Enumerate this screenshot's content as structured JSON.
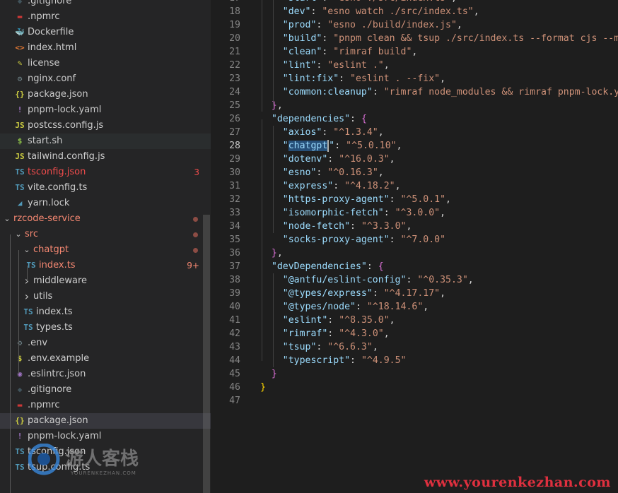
{
  "explorer": {
    "items": [
      {
        "label": ".gitignore",
        "icon": "git-icon",
        "glyph": "◆",
        "color": "#41535b",
        "indent": 1
      },
      {
        "label": ".npmrc",
        "icon": "npm-icon",
        "glyph": "▬",
        "color": "#cb3837",
        "indent": 1
      },
      {
        "label": "Dockerfile",
        "icon": "docker-icon",
        "glyph": "🐳",
        "color": "#0db7ed",
        "indent": 1
      },
      {
        "label": "index.html",
        "icon": "html-icon",
        "glyph": "<>",
        "color": "#e37933",
        "indent": 1
      },
      {
        "label": "license",
        "icon": "license-icon",
        "glyph": "✎",
        "color": "#cbcb41",
        "indent": 1
      },
      {
        "label": "nginx.conf",
        "icon": "gear-icon",
        "glyph": "⚙",
        "color": "#6d8086",
        "indent": 1
      },
      {
        "label": "package.json",
        "icon": "json-icon",
        "glyph": "{}",
        "color": "#cbcb41",
        "indent": 1
      },
      {
        "label": "pnpm-lock.yaml",
        "icon": "yaml-icon",
        "glyph": "!",
        "color": "#a074c4",
        "indent": 1
      },
      {
        "label": "postcss.config.js",
        "icon": "js-icon",
        "glyph": "JS",
        "color": "#cbcb41",
        "indent": 1
      },
      {
        "label": "start.sh",
        "icon": "shell-icon",
        "glyph": "$",
        "color": "#8dc149",
        "indent": 1,
        "hover": true
      },
      {
        "label": "tailwind.config.js",
        "icon": "js-icon",
        "glyph": "JS",
        "color": "#cbcb41",
        "indent": 1
      },
      {
        "label": "tsconfig.json",
        "icon": "ts-icon",
        "glyph": "TS",
        "color": "#519aba",
        "indent": 1,
        "labelColor": "#f14c4c",
        "badge": "3",
        "badgeColor": "#f14c4c"
      },
      {
        "label": "vite.config.ts",
        "icon": "ts-icon",
        "glyph": "TS",
        "color": "#519aba",
        "indent": 1
      },
      {
        "label": "yarn.lock",
        "icon": "yarn-icon",
        "glyph": "◢",
        "color": "#519aba",
        "indent": 1
      },
      {
        "label": "rzcode-service",
        "icon": "folder-icon",
        "folder": true,
        "open": true,
        "indent": 0,
        "labelColor": "#f48771",
        "dot": true
      },
      {
        "label": "src",
        "icon": "folder-icon",
        "folder": true,
        "open": true,
        "indent": 1,
        "labelColor": "#f48771",
        "dot": true
      },
      {
        "label": "chatgpt",
        "icon": "folder-icon",
        "folder": true,
        "open": true,
        "indent": 2,
        "labelColor": "#f48771",
        "dot": true
      },
      {
        "label": "index.ts",
        "icon": "ts-icon",
        "glyph": "TS",
        "color": "#519aba",
        "indent": 3,
        "labelColor": "#f48771",
        "badge": "9+",
        "badgeColor": "#f48771"
      },
      {
        "label": "middleware",
        "icon": "folder-icon",
        "folder": true,
        "open": false,
        "indent": 2
      },
      {
        "label": "utils",
        "icon": "folder-icon",
        "folder": true,
        "open": false,
        "indent": 2
      },
      {
        "label": "index.ts",
        "icon": "ts-icon",
        "glyph": "TS",
        "color": "#519aba",
        "indent": 2
      },
      {
        "label": "types.ts",
        "icon": "ts-icon",
        "glyph": "TS",
        "color": "#519aba",
        "indent": 2
      },
      {
        "label": ".env",
        "icon": "gear-icon",
        "glyph": "⚙",
        "color": "#6d8086",
        "indent": 1
      },
      {
        "label": ".env.example",
        "icon": "shell-icon",
        "glyph": "$",
        "color": "#cbcb41",
        "indent": 1
      },
      {
        "label": ".eslintrc.json",
        "icon": "eslint-icon",
        "glyph": "◉",
        "color": "#a074c4",
        "indent": 1
      },
      {
        "label": ".gitignore",
        "icon": "git-icon",
        "glyph": "◆",
        "color": "#41535b",
        "indent": 1
      },
      {
        "label": ".npmrc",
        "icon": "npm-icon",
        "glyph": "▬",
        "color": "#cb3837",
        "indent": 1
      },
      {
        "label": "package.json",
        "icon": "json-icon",
        "glyph": "{}",
        "color": "#cbcb41",
        "indent": 1,
        "selected": true
      },
      {
        "label": "pnpm-lock.yaml",
        "icon": "yaml-icon",
        "glyph": "!",
        "color": "#a074c4",
        "indent": 1
      },
      {
        "label": "tsconfig.json",
        "icon": "ts-icon",
        "glyph": "TS",
        "color": "#519aba",
        "indent": 1
      },
      {
        "label": "tsup.config.ts",
        "icon": "ts-icon",
        "glyph": "TS",
        "color": "#519aba",
        "indent": 1
      }
    ]
  },
  "editor": {
    "current_line": 28,
    "lines": [
      {
        "n": 17,
        "tokens": [
          [
            "p",
            "    "
          ],
          [
            "key",
            "\"start\""
          ],
          [
            "p",
            ": "
          ],
          [
            "str",
            "\"esno ./src/index.ts\""
          ],
          [
            "p",
            ","
          ]
        ]
      },
      {
        "n": 18,
        "tokens": [
          [
            "p",
            "    "
          ],
          [
            "key",
            "\"dev\""
          ],
          [
            "p",
            ": "
          ],
          [
            "str",
            "\"esno watch ./src/index.ts\""
          ],
          [
            "p",
            ","
          ]
        ]
      },
      {
        "n": 19,
        "tokens": [
          [
            "p",
            "    "
          ],
          [
            "key",
            "\"prod\""
          ],
          [
            "p",
            ": "
          ],
          [
            "str",
            "\"esno ./build/index.js\""
          ],
          [
            "p",
            ","
          ]
        ]
      },
      {
        "n": 20,
        "tokens": [
          [
            "p",
            "    "
          ],
          [
            "key",
            "\"build\""
          ],
          [
            "p",
            ": "
          ],
          [
            "str",
            "\"pnpm clean && tsup ./src/index.ts --format cjs --min"
          ]
        ]
      },
      {
        "n": 21,
        "tokens": [
          [
            "p",
            "    "
          ],
          [
            "key",
            "\"clean\""
          ],
          [
            "p",
            ": "
          ],
          [
            "str",
            "\"rimraf build\""
          ],
          [
            "p",
            ","
          ]
        ]
      },
      {
        "n": 22,
        "tokens": [
          [
            "p",
            "    "
          ],
          [
            "key",
            "\"lint\""
          ],
          [
            "p",
            ": "
          ],
          [
            "str",
            "\"eslint .\""
          ],
          [
            "p",
            ","
          ]
        ]
      },
      {
        "n": 23,
        "tokens": [
          [
            "p",
            "    "
          ],
          [
            "key",
            "\"lint:fix\""
          ],
          [
            "p",
            ": "
          ],
          [
            "str",
            "\"eslint . --fix\""
          ],
          [
            "p",
            ","
          ]
        ]
      },
      {
        "n": 24,
        "tokens": [
          [
            "p",
            "    "
          ],
          [
            "key",
            "\"common:cleanup\""
          ],
          [
            "p",
            ": "
          ],
          [
            "str",
            "\"rimraf node_modules && rimraf pnpm-lock.yam"
          ]
        ]
      },
      {
        "n": 25,
        "tokens": [
          [
            "p",
            "  "
          ],
          [
            "b1",
            "}"
          ],
          [
            "p",
            ","
          ]
        ]
      },
      {
        "n": 26,
        "tokens": [
          [
            "p",
            "  "
          ],
          [
            "key",
            "\"dependencies\""
          ],
          [
            "p",
            ": "
          ],
          [
            "b1",
            "{"
          ]
        ]
      },
      {
        "n": 27,
        "tokens": [
          [
            "p",
            "    "
          ],
          [
            "key",
            "\"axios\""
          ],
          [
            "p",
            ": "
          ],
          [
            "str",
            "\"^1.3.4\""
          ],
          [
            "p",
            ","
          ]
        ]
      },
      {
        "n": 28,
        "tokens": [
          [
            "p",
            "    "
          ],
          [
            "key",
            "\""
          ],
          [
            "sel",
            "chatgpt"
          ],
          [
            "cursor",
            ""
          ],
          [
            "key",
            "\""
          ],
          [
            "p",
            ": "
          ],
          [
            "str",
            "\"^5.0.10\""
          ],
          [
            "p",
            ","
          ]
        ]
      },
      {
        "n": 29,
        "tokens": [
          [
            "p",
            "    "
          ],
          [
            "key",
            "\"dotenv\""
          ],
          [
            "p",
            ": "
          ],
          [
            "str",
            "\"^16.0.3\""
          ],
          [
            "p",
            ","
          ]
        ]
      },
      {
        "n": 30,
        "tokens": [
          [
            "p",
            "    "
          ],
          [
            "key",
            "\"esno\""
          ],
          [
            "p",
            ": "
          ],
          [
            "str",
            "\"^0.16.3\""
          ],
          [
            "p",
            ","
          ]
        ]
      },
      {
        "n": 31,
        "tokens": [
          [
            "p",
            "    "
          ],
          [
            "key",
            "\"express\""
          ],
          [
            "p",
            ": "
          ],
          [
            "str",
            "\"^4.18.2\""
          ],
          [
            "p",
            ","
          ]
        ]
      },
      {
        "n": 32,
        "tokens": [
          [
            "p",
            "    "
          ],
          [
            "key",
            "\"https-proxy-agent\""
          ],
          [
            "p",
            ": "
          ],
          [
            "str",
            "\"^5.0.1\""
          ],
          [
            "p",
            ","
          ]
        ]
      },
      {
        "n": 33,
        "tokens": [
          [
            "p",
            "    "
          ],
          [
            "key",
            "\"isomorphic-fetch\""
          ],
          [
            "p",
            ": "
          ],
          [
            "str",
            "\"^3.0.0\""
          ],
          [
            "p",
            ","
          ]
        ]
      },
      {
        "n": 34,
        "tokens": [
          [
            "p",
            "    "
          ],
          [
            "key",
            "\"node-fetch\""
          ],
          [
            "p",
            ": "
          ],
          [
            "str",
            "\"^3.3.0\""
          ],
          [
            "p",
            ","
          ]
        ]
      },
      {
        "n": 35,
        "tokens": [
          [
            "p",
            "    "
          ],
          [
            "key",
            "\"socks-proxy-agent\""
          ],
          [
            "p",
            ": "
          ],
          [
            "str",
            "\"^7.0.0\""
          ]
        ]
      },
      {
        "n": 36,
        "tokens": [
          [
            "p",
            "  "
          ],
          [
            "b1",
            "}"
          ],
          [
            "p",
            ","
          ]
        ]
      },
      {
        "n": 37,
        "tokens": [
          [
            "p",
            "  "
          ],
          [
            "key",
            "\"devDependencies\""
          ],
          [
            "p",
            ": "
          ],
          [
            "b1",
            "{"
          ]
        ]
      },
      {
        "n": 38,
        "tokens": [
          [
            "p",
            "    "
          ],
          [
            "key",
            "\"@antfu/eslint-config\""
          ],
          [
            "p",
            ": "
          ],
          [
            "str",
            "\"^0.35.3\""
          ],
          [
            "p",
            ","
          ]
        ]
      },
      {
        "n": 39,
        "tokens": [
          [
            "p",
            "    "
          ],
          [
            "key",
            "\"@types/express\""
          ],
          [
            "p",
            ": "
          ],
          [
            "str",
            "\"^4.17.17\""
          ],
          [
            "p",
            ","
          ]
        ]
      },
      {
        "n": 40,
        "tokens": [
          [
            "p",
            "    "
          ],
          [
            "key",
            "\"@types/node\""
          ],
          [
            "p",
            ": "
          ],
          [
            "str",
            "\"^18.14.6\""
          ],
          [
            "p",
            ","
          ]
        ]
      },
      {
        "n": 41,
        "tokens": [
          [
            "p",
            "    "
          ],
          [
            "key",
            "\"eslint\""
          ],
          [
            "p",
            ": "
          ],
          [
            "str",
            "\"^8.35.0\""
          ],
          [
            "p",
            ","
          ]
        ]
      },
      {
        "n": 42,
        "tokens": [
          [
            "p",
            "    "
          ],
          [
            "key",
            "\"rimraf\""
          ],
          [
            "p",
            ": "
          ],
          [
            "str",
            "\"^4.3.0\""
          ],
          [
            "p",
            ","
          ]
        ]
      },
      {
        "n": 43,
        "tokens": [
          [
            "p",
            "    "
          ],
          [
            "key",
            "\"tsup\""
          ],
          [
            "p",
            ": "
          ],
          [
            "str",
            "\"^6.6.3\""
          ],
          [
            "p",
            ","
          ]
        ]
      },
      {
        "n": 44,
        "tokens": [
          [
            "p",
            "    "
          ],
          [
            "key",
            "\"typescript\""
          ],
          [
            "p",
            ": "
          ],
          [
            "str",
            "\"^4.9.5\""
          ]
        ]
      },
      {
        "n": 45,
        "tokens": [
          [
            "p",
            "  "
          ],
          [
            "b1",
            "}"
          ]
        ]
      },
      {
        "n": 46,
        "tokens": [
          [
            "b0",
            "}"
          ]
        ]
      },
      {
        "n": 47,
        "tokens": []
      }
    ]
  },
  "watermark": {
    "logo_text": "游人客栈",
    "logo_sub": "YOURENKEZHAN.COM",
    "url": "www.yourenkezhan.com"
  }
}
